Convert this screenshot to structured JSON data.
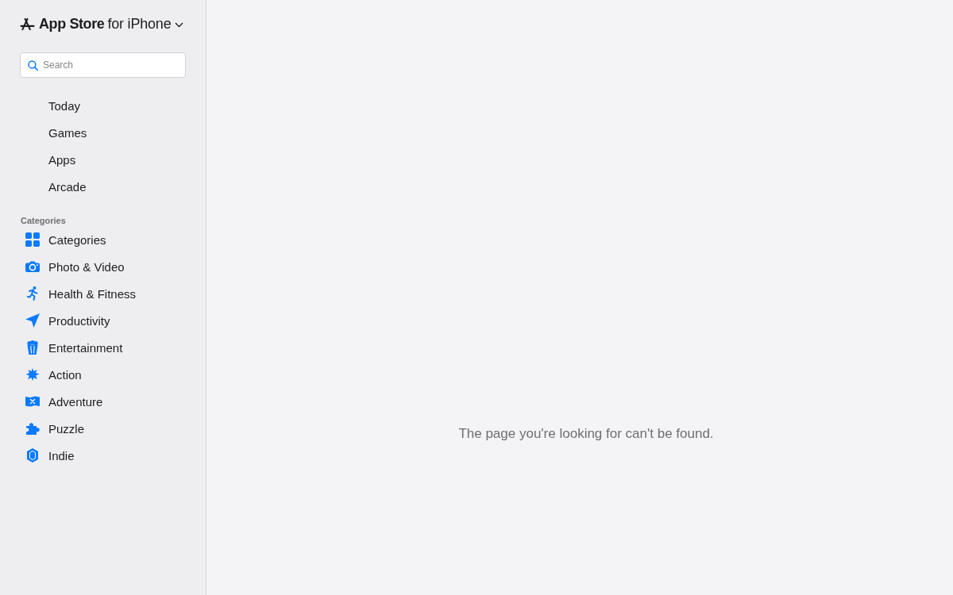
{
  "header": {
    "brand": "App Store",
    "platform": "for iPhone"
  },
  "search": {
    "placeholder": "Search"
  },
  "nav": [
    {
      "label": "Today"
    },
    {
      "label": "Games"
    },
    {
      "label": "Apps"
    },
    {
      "label": "Arcade"
    }
  ],
  "categories": {
    "heading": "Categories",
    "items": [
      {
        "label": "Categories"
      },
      {
        "label": "Photo & Video"
      },
      {
        "label": "Health & Fitness"
      },
      {
        "label": "Productivity"
      },
      {
        "label": "Entertainment"
      },
      {
        "label": "Action"
      },
      {
        "label": "Adventure"
      },
      {
        "label": "Puzzle"
      },
      {
        "label": "Indie"
      }
    ]
  },
  "message": "The page you're looking for can't be found."
}
